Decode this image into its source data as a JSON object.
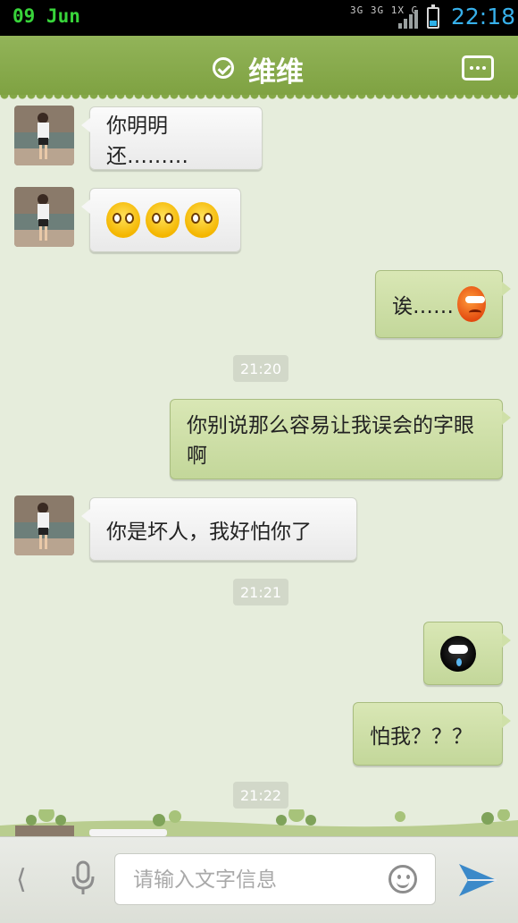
{
  "status_bar": {
    "date": "09 Jun",
    "network_labels": [
      "3G",
      "3G 1X",
      "G"
    ],
    "time": "22:18",
    "battery_icon": "battery-icon",
    "signal_icon": "signal-bars-icon"
  },
  "header": {
    "title": "维维",
    "status_icon": "check-circle-icon",
    "menu_icon": "chat-menu-icon"
  },
  "messages": [
    {
      "side": "left",
      "text": "你明明还………"
    },
    {
      "side": "left",
      "emoji": [
        "blush-emoji",
        "blush-emoji",
        "blush-emoji"
      ]
    },
    {
      "side": "right",
      "text": "诶……",
      "emoji": [
        "angry-emoji"
      ]
    },
    {
      "type": "timestamp",
      "text": "21:20"
    },
    {
      "side": "right",
      "text": "你别说那么容易让我误会的字眼啊"
    },
    {
      "side": "left",
      "text": "你是坏人，我好怕你了"
    },
    {
      "type": "timestamp",
      "text": "21:21"
    },
    {
      "side": "right",
      "emoji": [
        "black-crying-emoji"
      ]
    },
    {
      "side": "right",
      "text": "怕我？？？"
    },
    {
      "type": "timestamp",
      "text": "21:22"
    }
  ],
  "input_bar": {
    "placeholder": "请输入文字信息",
    "back_icon": "chevron-left-icon",
    "mic_icon": "microphone-icon",
    "emoji_icon": "smiley-icon",
    "send_icon": "send-icon"
  },
  "colors": {
    "header_green": "#8aad4f",
    "chat_background": "#e6eddc",
    "sent_bubble": "#cfe0a8",
    "received_bubble": "#f4f4f4",
    "status_time": "#37b0ea"
  }
}
